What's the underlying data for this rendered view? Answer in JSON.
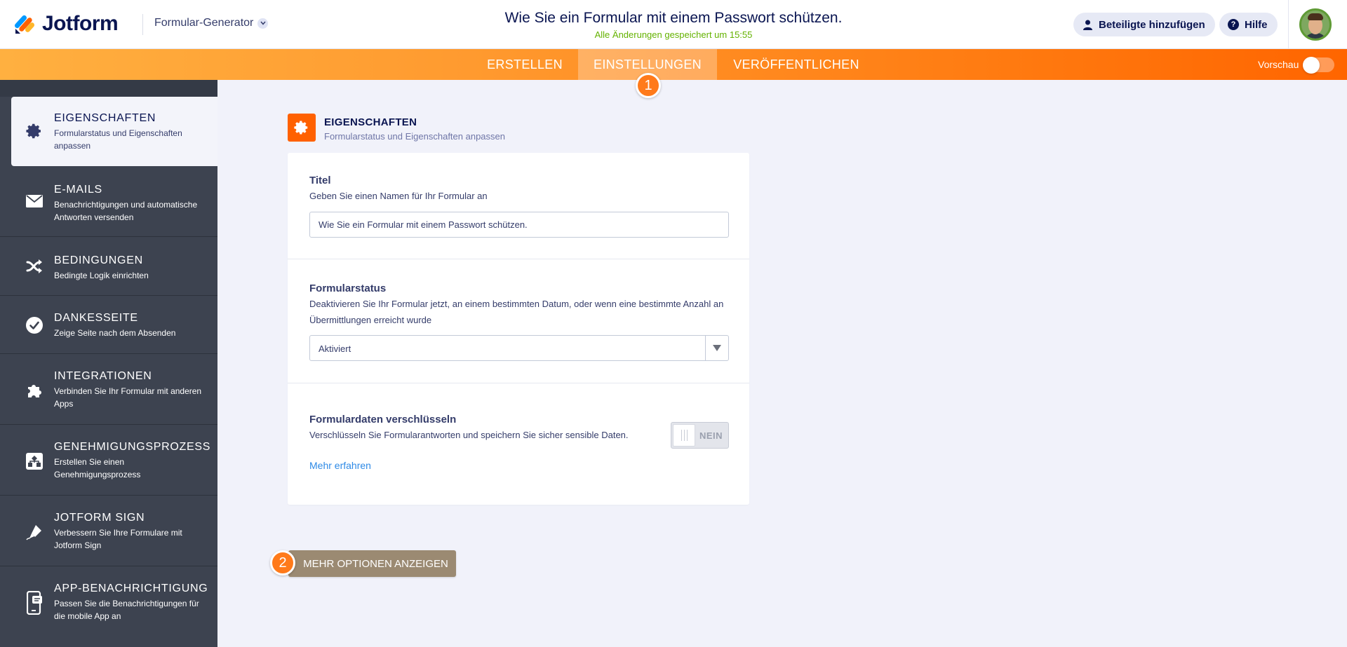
{
  "header": {
    "brand": "Jotform",
    "builder_menu": "Formular-Generator",
    "form_title": "Wie Sie ein Formular mit einem Passwort schützen.",
    "save_status": "Alle Änderungen gespeichert um 15:55",
    "invite_label": "Beteiligte hinzufügen",
    "help_label": "Hilfe",
    "help_glyph": "?"
  },
  "nav": {
    "tabs": [
      {
        "label": "ERSTELLEN"
      },
      {
        "label": "EINSTELLUNGEN"
      },
      {
        "label": "VERÖFFENTLICHEN"
      }
    ],
    "preview_label": "Vorschau",
    "preview_enabled": false
  },
  "steps": {
    "first": "1",
    "second": "2"
  },
  "sidebar": {
    "items": [
      {
        "title": "EIGENSCHAFTEN",
        "desc": "Formularstatus und Eigenschaften anpassen",
        "icon": "gear-icon"
      },
      {
        "title": "E-MAILS",
        "desc": "Benachrichtigungen und automatische Antworten versenden",
        "icon": "envelope-icon"
      },
      {
        "title": "BEDINGUNGEN",
        "desc": "Bedingte Logik einrichten",
        "icon": "shuffle-icon"
      },
      {
        "title": "DANKESSEITE",
        "desc": "Zeige Seite nach dem Absenden",
        "icon": "check-circle-icon"
      },
      {
        "title": "INTEGRATIONEN",
        "desc": "Verbinden Sie Ihr Formular mit anderen Apps",
        "icon": "puzzle-icon"
      },
      {
        "title": "GENEHMIGUNGSPROZESS",
        "desc": "Erstellen Sie einen Genehmigungsprozess",
        "icon": "workflow-icon"
      },
      {
        "title": "JOTFORM SIGN",
        "desc": "Verbessern Sie Ihre Formulare mit Jotform Sign",
        "icon": "pen-icon"
      },
      {
        "title": "APP-BENACHRICHTIGUNG",
        "desc": "Passen Sie die Benachrichtigungen für die mobile App an",
        "icon": "mobile-icon"
      }
    ]
  },
  "panel": {
    "title": "EIGENSCHAFTEN",
    "subtitle": "Formularstatus und Eigenschaften anpassen",
    "title_field": {
      "label": "Titel",
      "desc": "Geben Sie einen Namen für Ihr Formular an",
      "value": "Wie Sie ein Formular mit einem Passwort schützen."
    },
    "status_field": {
      "label": "Formularstatus",
      "desc": "Deaktivieren Sie Ihr Formular jetzt, an einem bestimmten Datum, oder wenn eine bestimmte Anzahl an Übermittlungen erreicht wurde",
      "value": "Aktiviert"
    },
    "encrypt_field": {
      "label": "Formulardaten verschlüsseln",
      "desc": "Verschlüsseln Sie Formularantworten und speichern Sie sicher sensible Daten.",
      "link": "Mehr erfahren",
      "toggle_label": "NEIN"
    },
    "more_button": "MEHR OPTIONEN ANZEIGEN"
  },
  "colors": {
    "accent": "#ff6100",
    "sidebar_bg": "#3d4350",
    "link": "#2e8ae6",
    "saved": "#64b200",
    "more_button": "#9b8a72"
  }
}
